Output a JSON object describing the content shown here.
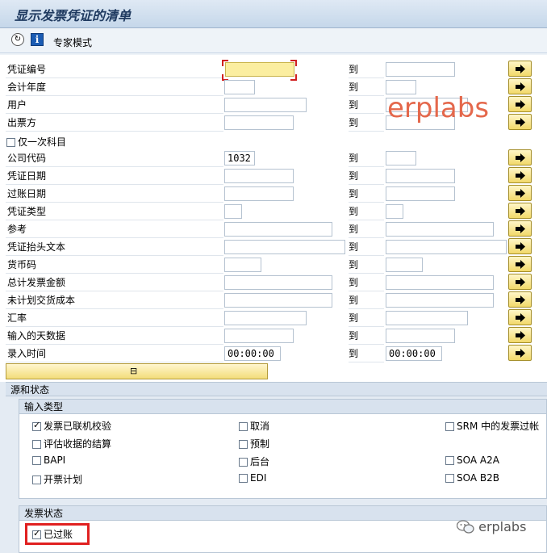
{
  "window": {
    "title": "显示发票凭证的清单"
  },
  "toolbar": {
    "expert_mode_label": "专家模式",
    "clock_icon": "clock-icon",
    "info_icon": "info-icon"
  },
  "to_label": "到",
  "fields": [
    {
      "label": "凭证编号"
    },
    {
      "label": "会计年度"
    },
    {
      "label": "用户"
    },
    {
      "label": "出票方"
    },
    {
      "label": "仅一次科目"
    },
    {
      "label": "公司代码",
      "low_value": "1032"
    },
    {
      "label": "凭证日期"
    },
    {
      "label": "过账日期"
    },
    {
      "label": "凭证类型"
    },
    {
      "label": "参考"
    },
    {
      "label": "凭证抬头文本"
    },
    {
      "label": "货币码"
    },
    {
      "label": "总计发票金额"
    },
    {
      "label": "未计划交货成本"
    },
    {
      "label": "汇率"
    },
    {
      "label": "输入的天数据"
    },
    {
      "label": "录入时间",
      "low_value": "00:00:00",
      "high_value": "00:00:00"
    }
  ],
  "source_status": {
    "title": "源和状态",
    "input_type": {
      "title": "输入类型",
      "options": [
        {
          "label": "发票已联机校验",
          "checked": true
        },
        {
          "label": "评估收据的结算",
          "checked": false
        },
        {
          "label": "BAPI",
          "checked": false
        },
        {
          "label": "开票计划",
          "checked": false
        },
        {
          "label": "取消",
          "checked": false
        },
        {
          "label": "预制",
          "checked": false
        },
        {
          "label": "后台",
          "checked": false
        },
        {
          "label": "EDI",
          "checked": false
        },
        {
          "label": "SRM 中的发票过帐",
          "checked": false
        },
        {
          "label": "SOA A2A",
          "checked": false
        },
        {
          "label": "SOA B2B",
          "checked": false
        }
      ]
    },
    "invoice_status": {
      "title": "发票状态",
      "options": [
        {
          "label": "已过账",
          "checked": true
        }
      ]
    }
  },
  "watermarks": {
    "center": "erplabs",
    "corner": "erplabs"
  }
}
